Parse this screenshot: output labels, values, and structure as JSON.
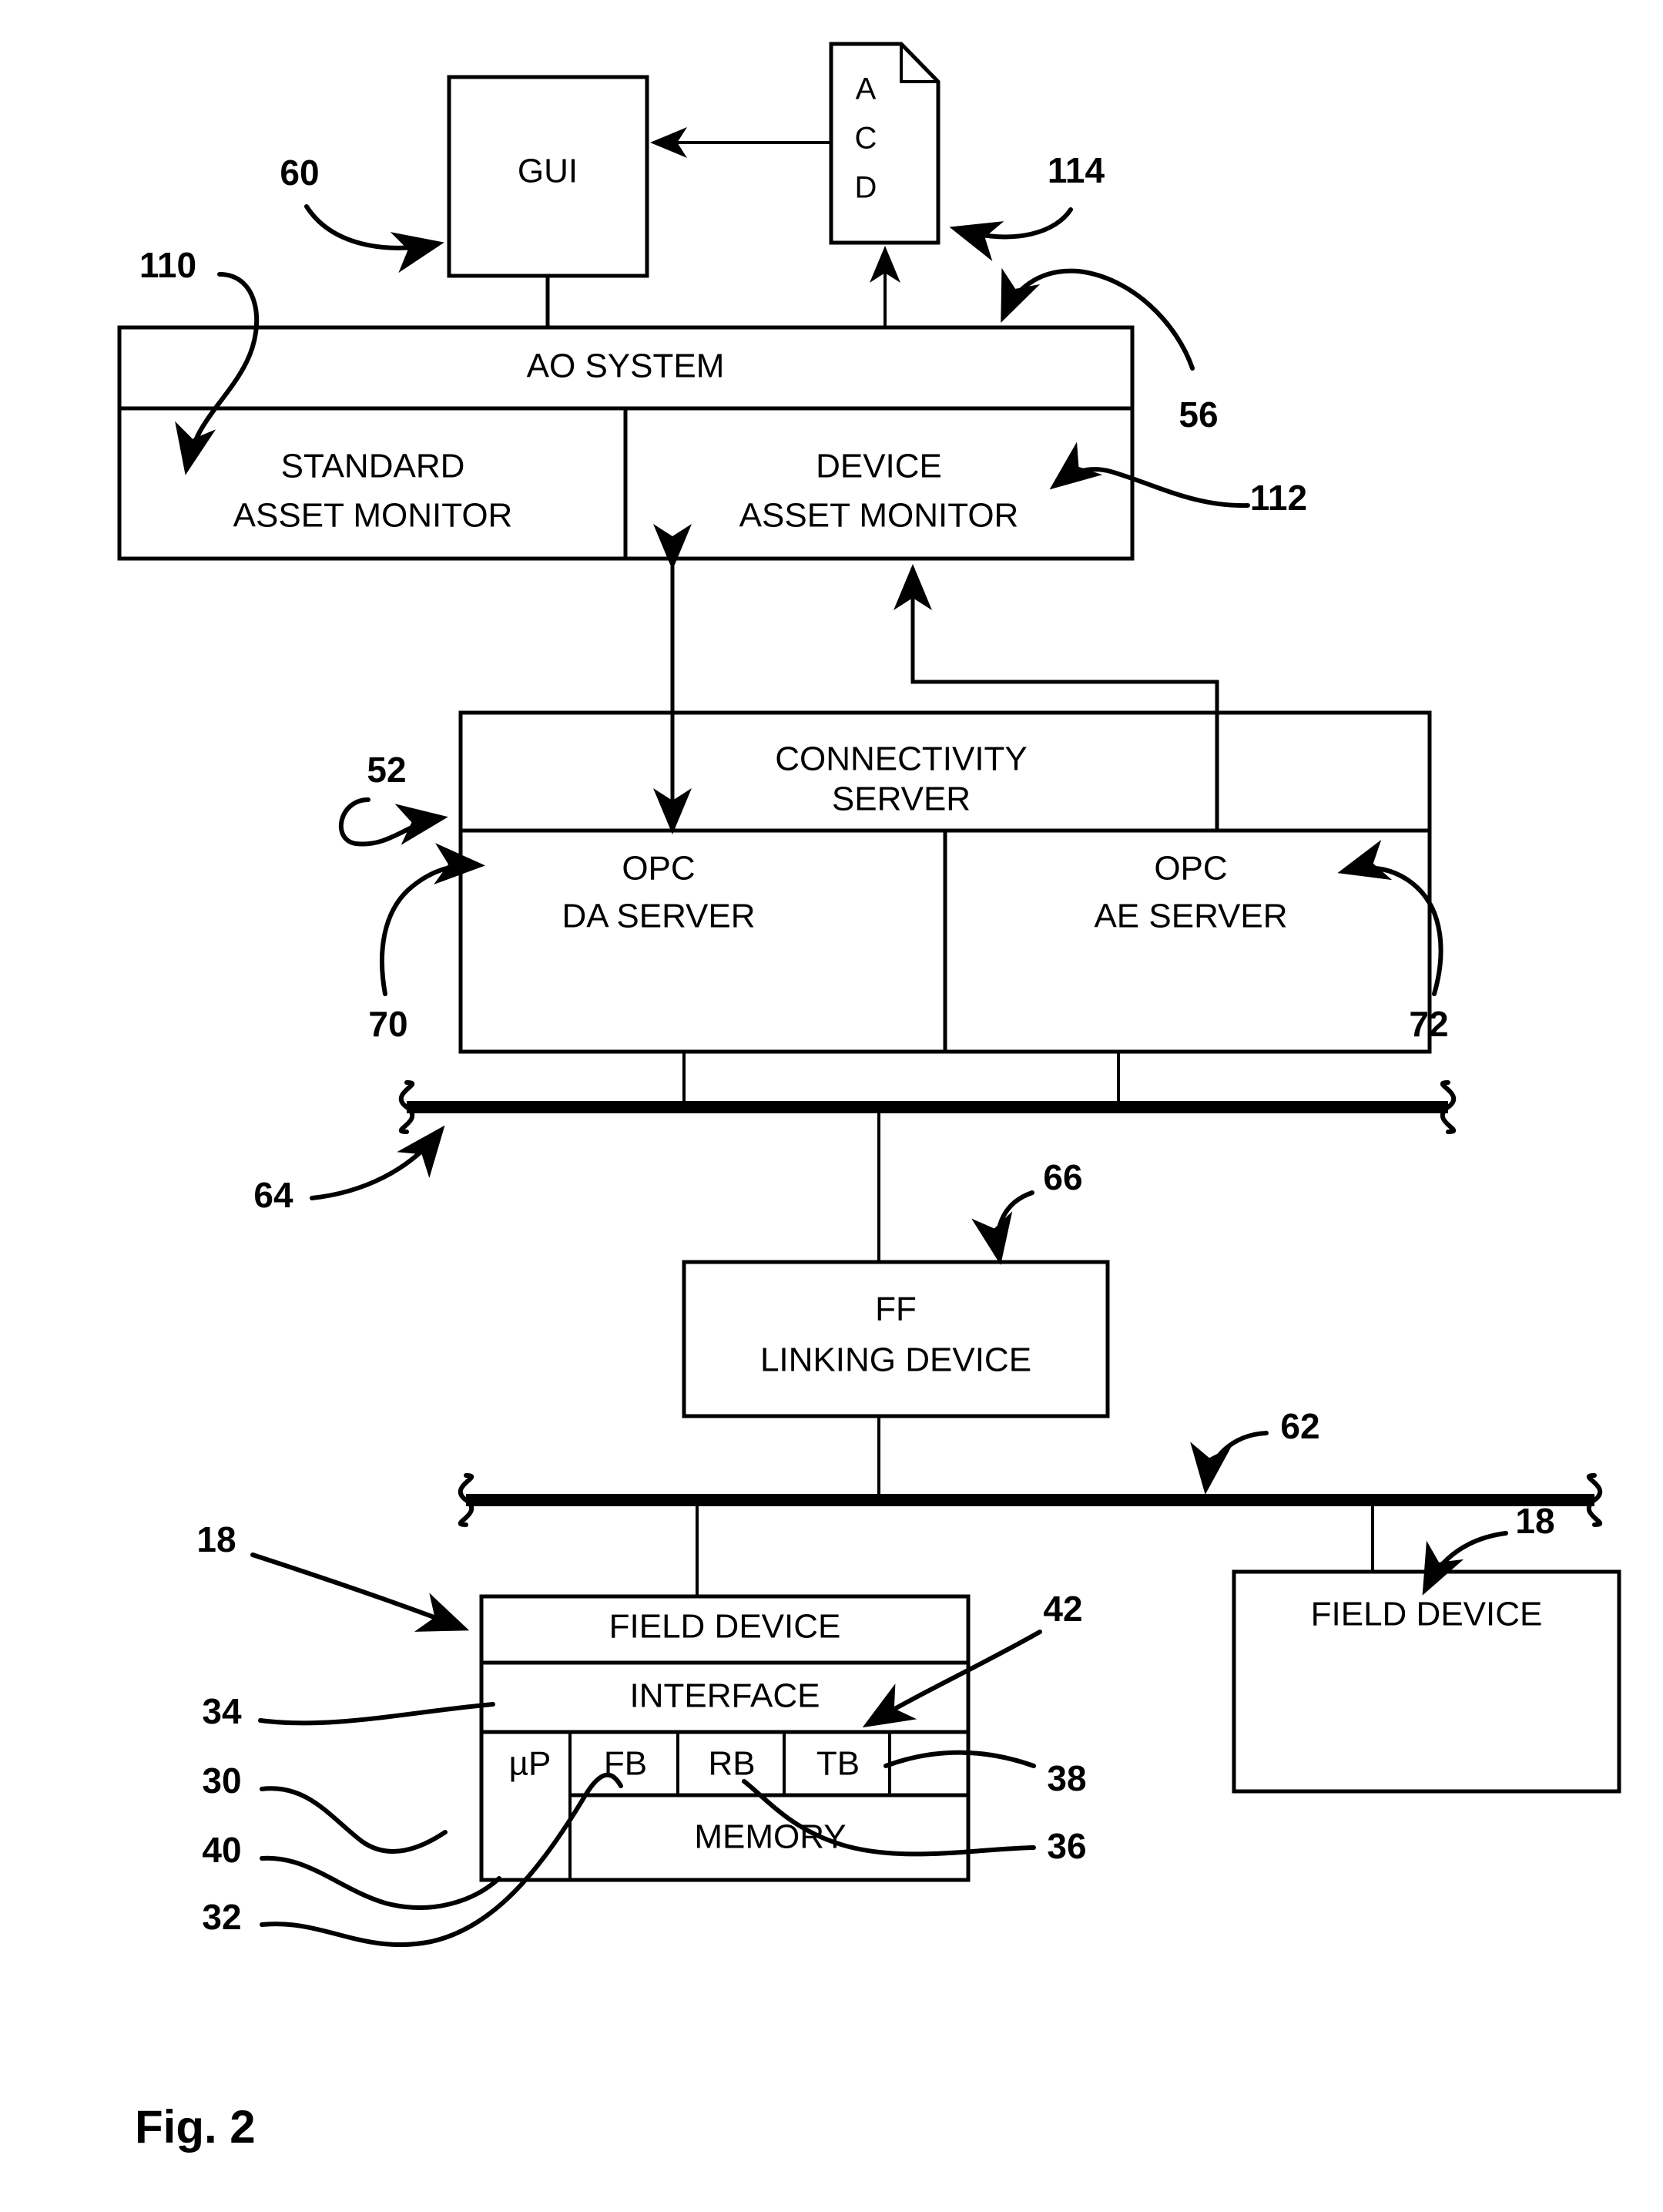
{
  "figure": {
    "caption": "Fig. 2"
  },
  "blocks": {
    "gui": {
      "label": "GUI"
    },
    "acd": {
      "line1": "A",
      "line2": "C",
      "line3": "D"
    },
    "ao_system": {
      "title": "AO SYSTEM"
    },
    "standard_asset_monitor": {
      "line1": "STANDARD",
      "line2": "ASSET MONITOR"
    },
    "device_asset_monitor": {
      "line1": "DEVICE",
      "line2": "ASSET MONITOR"
    },
    "connectivity_server": {
      "line1": "CONNECTIVITY",
      "line2": "SERVER"
    },
    "opc_da_server": {
      "line1": "OPC",
      "line2": "DA SERVER"
    },
    "opc_ae_server": {
      "line1": "OPC",
      "line2": "AE SERVER"
    },
    "ff_linking_device": {
      "line1": "FF",
      "line2": "LINKING DEVICE"
    },
    "field_device_left": {
      "title": "FIELD DEVICE"
    },
    "field_device_right": {
      "title": "FIELD DEVICE"
    },
    "interface": {
      "label": "INTERFACE"
    },
    "memory": {
      "label": "MEMORY"
    },
    "microprocessor": {
      "label": "µP"
    },
    "function_block": {
      "label": "FB"
    },
    "resource_block": {
      "label": "RB"
    },
    "transducer_block": {
      "label": "TB"
    }
  },
  "reference_numerals": {
    "n60": "60",
    "n110": "110",
    "n114": "114",
    "n56": "56",
    "n112": "112",
    "n52": "52",
    "n70": "70",
    "n72": "72",
    "n64": "64",
    "n66": "66",
    "n62": "62",
    "n18_left": "18",
    "n18_right": "18",
    "n34": "34",
    "n42": "42",
    "n30": "30",
    "n38": "38",
    "n40": "40",
    "n36": "36",
    "n32": "32"
  },
  "colors": {
    "ink": "#000000",
    "paper": "#ffffff"
  }
}
